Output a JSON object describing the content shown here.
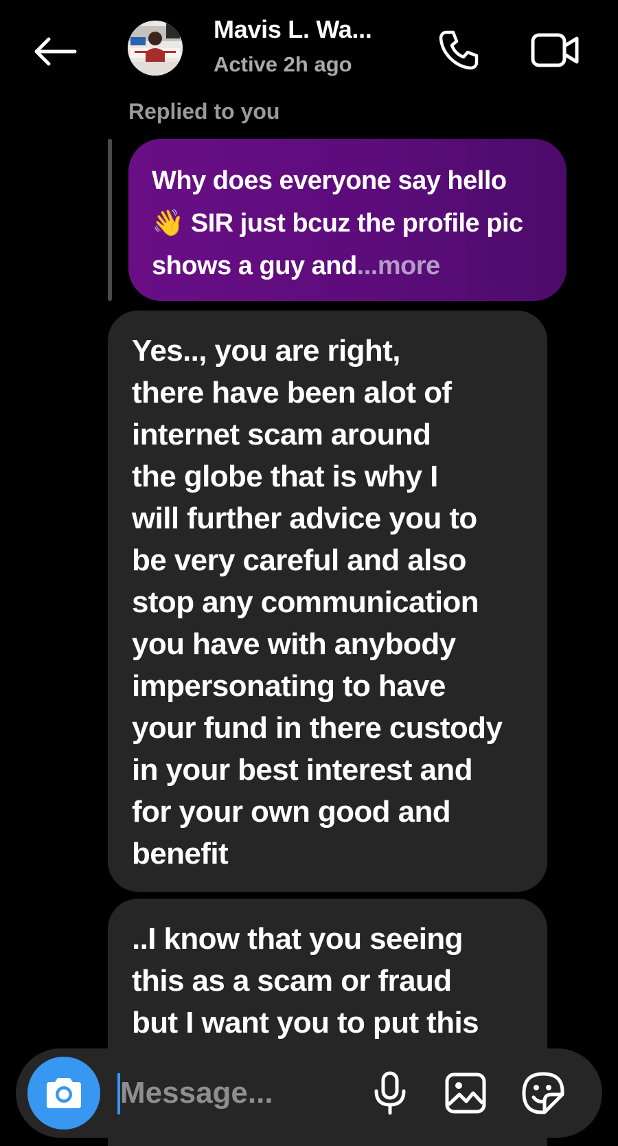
{
  "header": {
    "contact_name": "Mavis L. Wa...",
    "status": "Active 2h ago",
    "icons": {
      "back": "arrow-left-icon",
      "call": "phone-icon",
      "video": "video-camera-icon"
    }
  },
  "reply": {
    "label": "Replied to you",
    "quoted_text_before_emoji": "Why does everyone say hello ",
    "quoted_emoji": "👋",
    "quoted_text_after_emoji": " SIR just bcuz the profile pic shows a guy and",
    "more_label": "...more",
    "bubble_color": "#5b0c7a"
  },
  "messages": [
    {
      "text": "Yes.., you are right,\nthere have been alot of\ninternet scam around\nthe globe that is why I\nwill further advice you to\nbe very careful and also\nstop any communication\nyou have with anybody\nimpersonating to have\nyour fund in there custody\nin your best interest and\nfor your own good and\nbenefit"
    },
    {
      "text": "..I know that you seeing\nthis as a scam or fraud\nbut I want you to put this"
    }
  ],
  "composer": {
    "placeholder": "Message...",
    "icons": {
      "camera": "camera-icon",
      "mic": "microphone-icon",
      "gallery": "image-icon",
      "sticker": "sticker-icon"
    },
    "accent_color": "#3897f0"
  }
}
